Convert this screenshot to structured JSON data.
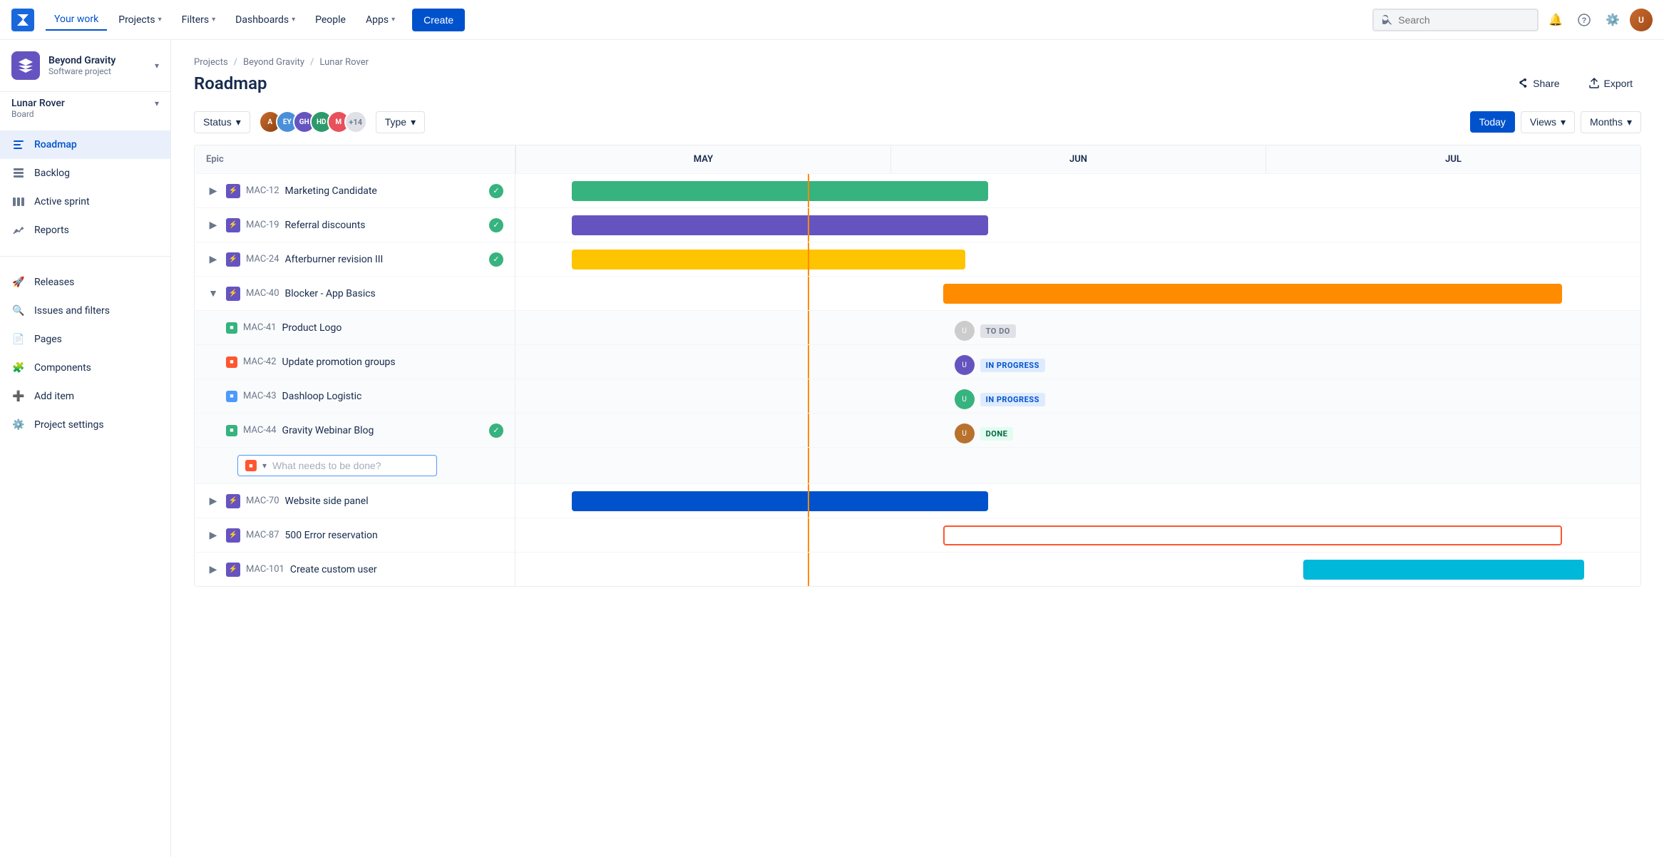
{
  "nav": {
    "logo_text": "Jira",
    "items": [
      {
        "label": "Your work",
        "active": true
      },
      {
        "label": "Projects",
        "chevron": true
      },
      {
        "label": "Filters",
        "chevron": true
      },
      {
        "label": "Dashboards",
        "chevron": true
      },
      {
        "label": "People"
      },
      {
        "label": "Apps",
        "chevron": true
      }
    ],
    "create_label": "Create",
    "search_placeholder": "Search"
  },
  "sidebar": {
    "project_name": "Beyond Gravity",
    "project_type": "Software project",
    "board_name": "Lunar Rover",
    "board_type": "Board",
    "nav_items": [
      {
        "label": "Roadmap",
        "active": true,
        "icon": "roadmap"
      },
      {
        "label": "Backlog",
        "icon": "backlog"
      },
      {
        "label": "Active sprint",
        "icon": "sprint"
      },
      {
        "label": "Reports",
        "icon": "reports"
      }
    ],
    "secondary_items": [
      {
        "label": "Releases",
        "icon": "releases"
      },
      {
        "label": "Issues and filters",
        "icon": "issues"
      },
      {
        "label": "Pages",
        "icon": "pages"
      },
      {
        "label": "Components",
        "icon": "components"
      },
      {
        "label": "Add item",
        "icon": "add"
      },
      {
        "label": "Project settings",
        "icon": "settings"
      }
    ]
  },
  "breadcrumb": [
    "Projects",
    "Beyond Gravity",
    "Lunar Rover"
  ],
  "page_title": "Roadmap",
  "actions": {
    "share": "Share",
    "export": "Export"
  },
  "toolbar": {
    "status_label": "Status",
    "type_label": "Type",
    "today_label": "Today",
    "views_label": "Views",
    "months_label": "Months",
    "avatar_count": "+14"
  },
  "months": [
    "MAY",
    "JUN",
    "JUL"
  ],
  "epic_label": "Epic",
  "epics": [
    {
      "key": "MAC-12",
      "name": "Marketing Candidate",
      "icon_type": "purple",
      "done": true,
      "bar_color": "green",
      "bar_start_pct": 5,
      "bar_width_pct": 38,
      "expanded": false
    },
    {
      "key": "MAC-19",
      "name": "Referral discounts",
      "icon_type": "purple",
      "done": true,
      "bar_color": "purple",
      "bar_start_pct": 5,
      "bar_width_pct": 38,
      "expanded": false
    },
    {
      "key": "MAC-24",
      "name": "Afterburner revision III",
      "icon_type": "purple",
      "done": true,
      "bar_color": "yellow",
      "bar_start_pct": 5,
      "bar_width_pct": 36,
      "expanded": false
    },
    {
      "key": "MAC-40",
      "name": "Blocker - App Basics",
      "icon_type": "purple",
      "done": false,
      "expanded": true,
      "bar_color": "orange",
      "bar_start_pct": 38,
      "bar_width_pct": 55,
      "children": [
        {
          "key": "MAC-41",
          "name": "Product Logo",
          "icon_type": "green",
          "status": "TO DO"
        },
        {
          "key": "MAC-42",
          "name": "Update promotion groups",
          "icon_type": "red",
          "status": "IN PROGRESS"
        },
        {
          "key": "MAC-43",
          "name": "Dashloop Logistic",
          "icon_type": "blue",
          "status": "IN PROGRESS"
        },
        {
          "key": "MAC-44",
          "name": "Gravity Webinar Blog",
          "icon_type": "green",
          "done": true,
          "status": "DONE"
        }
      ]
    },
    {
      "key": "MAC-70",
      "name": "Website side panel",
      "icon_type": "purple",
      "done": false,
      "bar_color": "blue",
      "bar_start_pct": 5,
      "bar_width_pct": 38,
      "expanded": false
    },
    {
      "key": "MAC-87",
      "name": "500 Error reservation",
      "icon_type": "purple",
      "done": false,
      "bar_color": "red-outline",
      "bar_start_pct": 38,
      "bar_width_pct": 55,
      "expanded": false
    },
    {
      "key": "MAC-101",
      "name": "Create custom user",
      "icon_type": "purple",
      "done": false,
      "bar_color": "teal",
      "bar_start_pct": 70,
      "bar_width_pct": 25,
      "expanded": false
    }
  ]
}
